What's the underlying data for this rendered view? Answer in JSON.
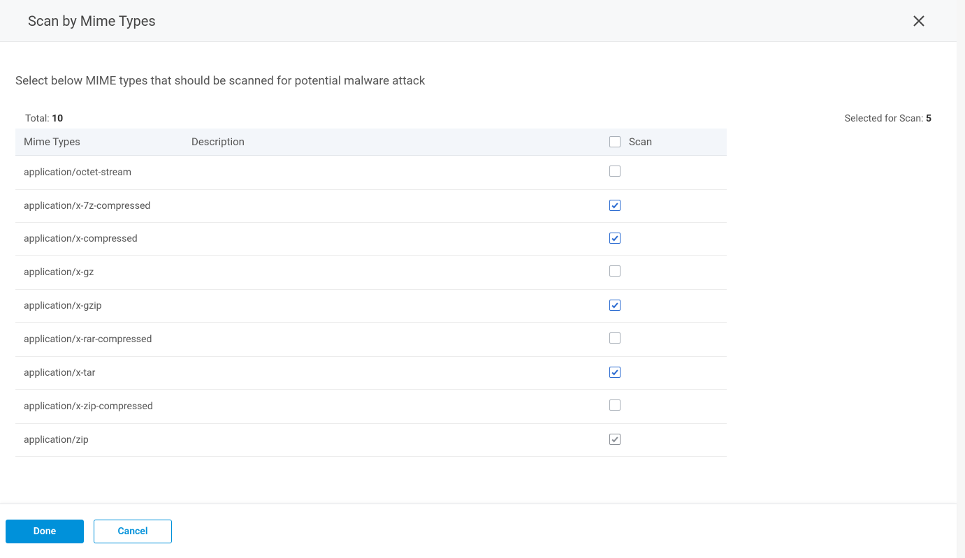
{
  "dialog": {
    "title": "Scan by Mime Types",
    "instruction": "Select below MIME types that should be scanned for potential malware attack"
  },
  "summary": {
    "total_label": "Total:",
    "total_count": "10",
    "selected_label": "Selected for Scan:",
    "selected_count": "5"
  },
  "table": {
    "headers": {
      "mime": "Mime Types",
      "desc": "Description",
      "scan": "Scan"
    },
    "rows": [
      {
        "mime": "application/octet-stream",
        "desc": "",
        "scan": false
      },
      {
        "mime": "application/x-7z-compressed",
        "desc": "",
        "scan": true
      },
      {
        "mime": "application/x-compressed",
        "desc": "",
        "scan": true
      },
      {
        "mime": "application/x-gz",
        "desc": "",
        "scan": false
      },
      {
        "mime": "application/x-gzip",
        "desc": "",
        "scan": true
      },
      {
        "mime": "application/x-rar-compressed",
        "desc": "",
        "scan": false
      },
      {
        "mime": "application/x-tar",
        "desc": "",
        "scan": true
      },
      {
        "mime": "application/x-zip-compressed",
        "desc": "",
        "scan": false
      },
      {
        "mime": "application/zip",
        "desc": "",
        "scan": true,
        "grey": true
      }
    ]
  },
  "footer": {
    "done": "Done",
    "cancel": "Cancel"
  }
}
